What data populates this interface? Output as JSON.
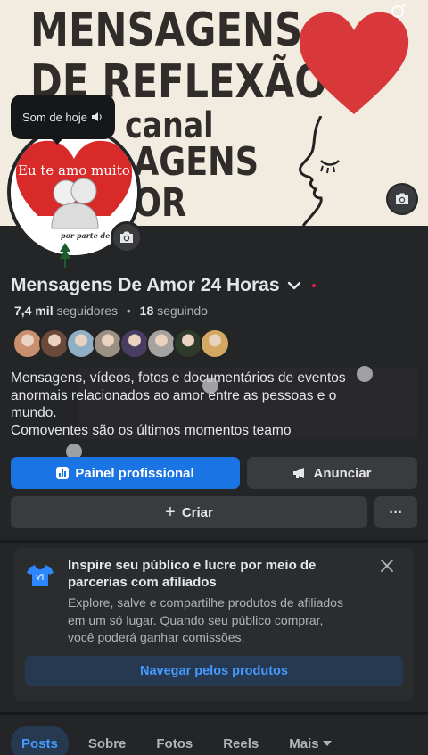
{
  "cover": {
    "line1": "MENSAGENS",
    "line2": "DE REFLEXÃO",
    "line3": "canal",
    "line4": "AGENS",
    "line5": "OR"
  },
  "tooltip": {
    "text": "Som de hoje"
  },
  "avatar": {
    "text": "Eu te amo muito!",
    "signature": "por parte de"
  },
  "profile": {
    "name": "Mensagens De Amor 24 Horas",
    "followers_count": "7,4 mil",
    "followers_label": "seguidores",
    "separator": "•",
    "following_count": "18",
    "following_label": "seguindo"
  },
  "friends": [
    "#c98f6e",
    "#6b4a3a",
    "#8fb0c4",
    "#9c8f84",
    "#4a3d63",
    "#a6a2a0",
    "#2e3a2a",
    "#d3a861"
  ],
  "bio": {
    "line1": "Mensagens, vídeos, fotos e documentários de eventos",
    "line2": "anormais relacionados ao amor entre as pessoas e o",
    "line3": "mundo.",
    "line4": "Comoventes são os últimos momentos teamo"
  },
  "buttons": {
    "dashboard": "Painel profissional",
    "advertise": "Anunciar",
    "create": "Criar",
    "more": "···"
  },
  "promo": {
    "title": "Inspire seu público e lucre por meio de parcerias com afiliados",
    "desc_line1": "Explore, salve e compartilhe produtos de afiliados",
    "desc_line2": "em um só lugar. Quando seu público comprar,",
    "desc_line3": "você poderá ganhar comissões.",
    "button": "Navegar pelos produtos"
  },
  "tabs": [
    {
      "label": "Posts"
    },
    {
      "label": "Sobre"
    },
    {
      "label": "Fotos"
    },
    {
      "label": "Reels"
    },
    {
      "label": "Mais"
    }
  ],
  "colors": {
    "accent": "#1b74e4",
    "link": "#4599ff",
    "background": "#242526",
    "heart": "#d9383b"
  }
}
